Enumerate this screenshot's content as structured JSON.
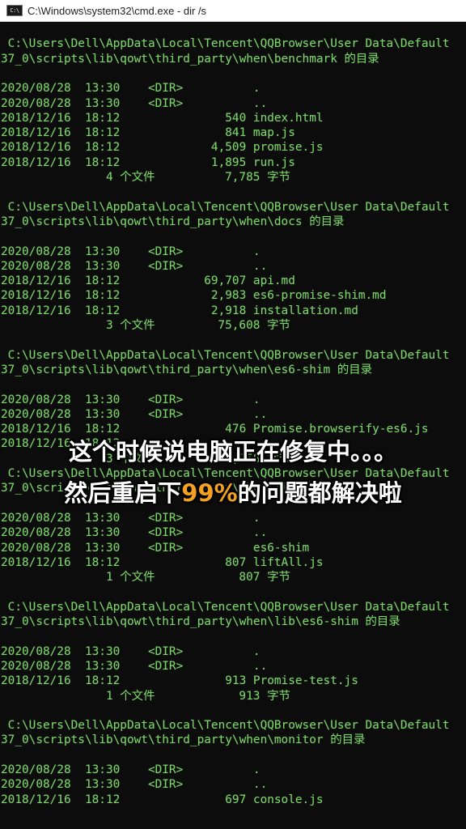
{
  "window": {
    "title": "C:\\Windows\\system32\\cmd.exe - dir /s",
    "icon_text": "C:\\"
  },
  "console_lines": [
    "",
    " C:\\Users\\Dell\\AppData\\Local\\Tencent\\QQBrowser\\User Data\\Default",
    "37_0\\scripts\\lib\\qowt\\third_party\\when\\benchmark 的目录",
    "",
    "2020/08/28  13:30    <DIR>          .",
    "2020/08/28  13:30    <DIR>          ..",
    "2018/12/16  18:12               540 index.html",
    "2018/12/16  18:12               841 map.js",
    "2018/12/16  18:12             4,509 promise.js",
    "2018/12/16  18:12             1,895 run.js",
    "               4 个文件          7,785 字节",
    "",
    " C:\\Users\\Dell\\AppData\\Local\\Tencent\\QQBrowser\\User Data\\Default",
    "37_0\\scripts\\lib\\qowt\\third_party\\when\\docs 的目录",
    "",
    "2020/08/28  13:30    <DIR>          .",
    "2020/08/28  13:30    <DIR>          ..",
    "2018/12/16  18:12            69,707 api.md",
    "2018/12/16  18:12             2,983 es6-promise-shim.md",
    "2018/12/16  18:12             2,918 installation.md",
    "               3 个文件         75,608 字节",
    "",
    " C:\\Users\\Dell\\AppData\\Local\\Tencent\\QQBrowser\\User Data\\Default",
    "37_0\\scripts\\lib\\qowt\\third_party\\when\\es6-shim 的目录",
    "",
    "2020/08/28  13:30    <DIR>          .",
    "2020/08/28  13:30    <DIR>          ..",
    "2018/12/16  18:12               476 Promise.browserify-es6.js",
    "2018/12/16  18:12",
    "               3 个文件         25,858 字节",
    " C:\\Users\\Dell\\AppData\\Local\\Tencent\\QQBrowser\\User Data\\Default",
    "37_0\\scripts\\lib\\qowt\\third_party\\when\\lib 的目录",
    "",
    "2020/08/28  13:30    <DIR>          .",
    "2020/08/28  13:30    <DIR>          ..",
    "2020/08/28  13:30    <DIR>          es6-shim",
    "2018/12/16  18:12               807 liftAll.js",
    "               1 个文件            807 字节",
    "",
    " C:\\Users\\Dell\\AppData\\Local\\Tencent\\QQBrowser\\User Data\\Default",
    "37_0\\scripts\\lib\\qowt\\third_party\\when\\lib\\es6-shim 的目录",
    "",
    "2020/08/28  13:30    <DIR>          .",
    "2020/08/28  13:30    <DIR>          ..",
    "2018/12/16  18:12               913 Promise-test.js",
    "               1 个文件            913 字节",
    "",
    " C:\\Users\\Dell\\AppData\\Local\\Tencent\\QQBrowser\\User Data\\Default",
    "37_0\\scripts\\lib\\qowt\\third_party\\when\\monitor 的目录",
    "",
    "2020/08/28  13:30    <DIR>          .",
    "2020/08/28  13:30    <DIR>          ..",
    "2018/12/16  18:12               697 console.js"
  ],
  "subtitles": {
    "line1": "这个时候说电脑正在修复中。。。",
    "line2_prefix": "然后重启下",
    "line2_highlight": "99%",
    "line2_suffix": "的问题都解决啦"
  },
  "colors": {
    "console_bg": "#0c0c0c",
    "console_text": "#7dd36b",
    "subtitle_text": "#ffffff",
    "subtitle_highlight": "#f3a11f"
  }
}
